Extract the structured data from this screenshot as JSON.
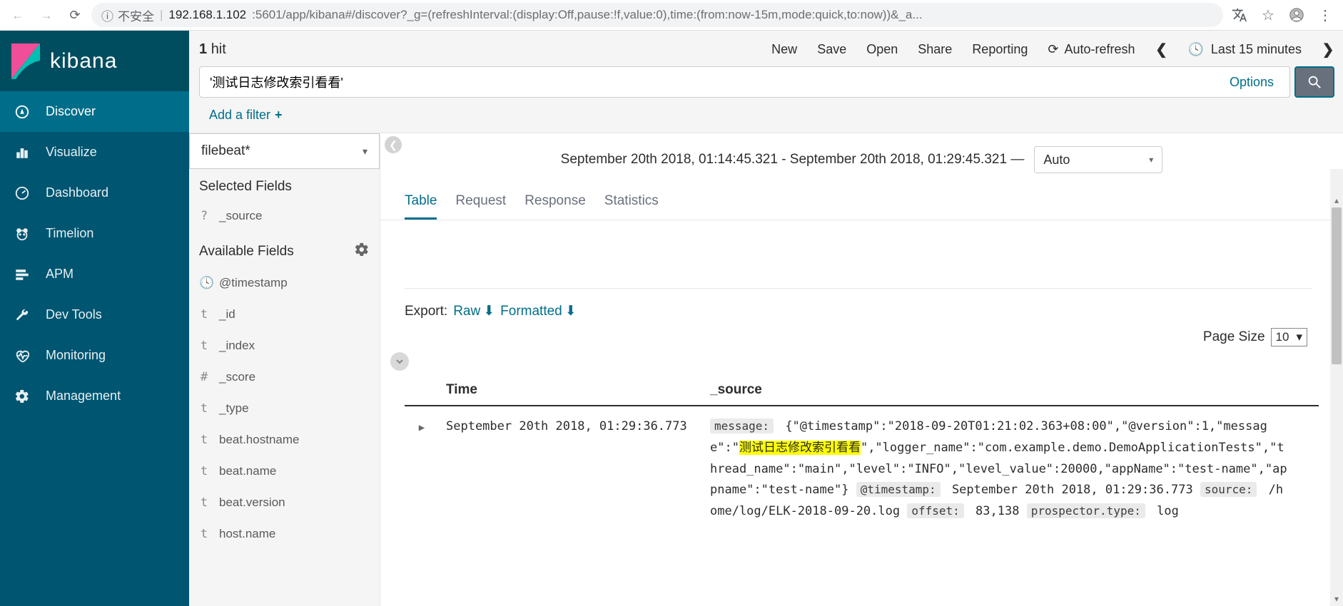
{
  "browser": {
    "insecure_label": "不安全",
    "url_host": "192.168.1.102",
    "url_port_path": ":5601/app/kibana#/discover?_g=(refreshInterval:(display:Off,pause:!f,value:0),time:(from:now-15m,mode:quick,to:now))&_a..."
  },
  "brand": "kibana",
  "nav": [
    {
      "label": "Discover",
      "icon": "compass",
      "active": true
    },
    {
      "label": "Visualize",
      "icon": "bar-chart",
      "active": false
    },
    {
      "label": "Dashboard",
      "icon": "gauge",
      "active": false
    },
    {
      "label": "Timelion",
      "icon": "bear",
      "active": false
    },
    {
      "label": "APM",
      "icon": "apm",
      "active": false
    },
    {
      "label": "Dev Tools",
      "icon": "wrench",
      "active": false
    },
    {
      "label": "Monitoring",
      "icon": "heartbeat",
      "active": false
    },
    {
      "label": "Management",
      "icon": "gear",
      "active": false
    }
  ],
  "topbar": {
    "hit_count": "1",
    "hit_label": "hit",
    "actions": {
      "new": "New",
      "save": "Save",
      "open": "Open",
      "share": "Share",
      "reporting": "Reporting"
    },
    "autorefresh_label": "Auto-refresh",
    "time_label": "Last 15 minutes"
  },
  "search": {
    "query": "'测试日志修改索引看看'",
    "options_label": "Options"
  },
  "filter_bar": {
    "add_label": "Add a filter"
  },
  "index_pattern": "filebeat*",
  "fields": {
    "selected_header": "Selected Fields",
    "available_header": "Available Fields",
    "selected": [
      {
        "type": "?",
        "name": "_source"
      }
    ],
    "available": [
      {
        "type": "clock",
        "name": "@timestamp"
      },
      {
        "type": "t",
        "name": "_id"
      },
      {
        "type": "t",
        "name": "_index"
      },
      {
        "type": "#",
        "name": "_score"
      },
      {
        "type": "t",
        "name": "_type"
      },
      {
        "type": "t",
        "name": "beat.hostname"
      },
      {
        "type": "t",
        "name": "beat.name"
      },
      {
        "type": "t",
        "name": "beat.version"
      },
      {
        "type": "t",
        "name": "host.name"
      }
    ]
  },
  "results": {
    "time_range": "September 20th 2018, 01:14:45.321 - September 20th 2018, 01:29:45.321 —",
    "interval": "Auto",
    "tabs": [
      "Table",
      "Request",
      "Response",
      "Statistics"
    ],
    "active_tab": "Table",
    "export_label": "Export:",
    "export_raw": "Raw",
    "export_formatted": "Formatted",
    "page_size_label": "Page Size",
    "page_size_value": "10",
    "columns": {
      "time": "Time",
      "source": "_source"
    },
    "row": {
      "time": "September 20th 2018, 01:29:36.773",
      "message_key": "message:",
      "message_pre": "{\"@timestamp\":\"2018-09-20T01:21:02.363+08:00\",\"@version\":1,\"message\":\"",
      "message_highlight": "测试日志修改索引看看",
      "message_post": "\",\"logger_name\":\"com.example.demo.DemoApplicationTests\",\"thread_name\":\"main\",\"level\":\"INFO\",\"level_value\":20000,\"appName\":\"test-name\",\"appname\":\"test-name\"}",
      "timestamp_key": "@timestamp:",
      "timestamp_val": "September 20th 2018, 01:29:36.773",
      "source_key": "source:",
      "source_val": "/home/log/ELK-2018-09-20.log",
      "offset_key": "offset:",
      "offset_val": "83,138",
      "prospector_key": "prospector.type:",
      "prospector_val": "log"
    }
  }
}
